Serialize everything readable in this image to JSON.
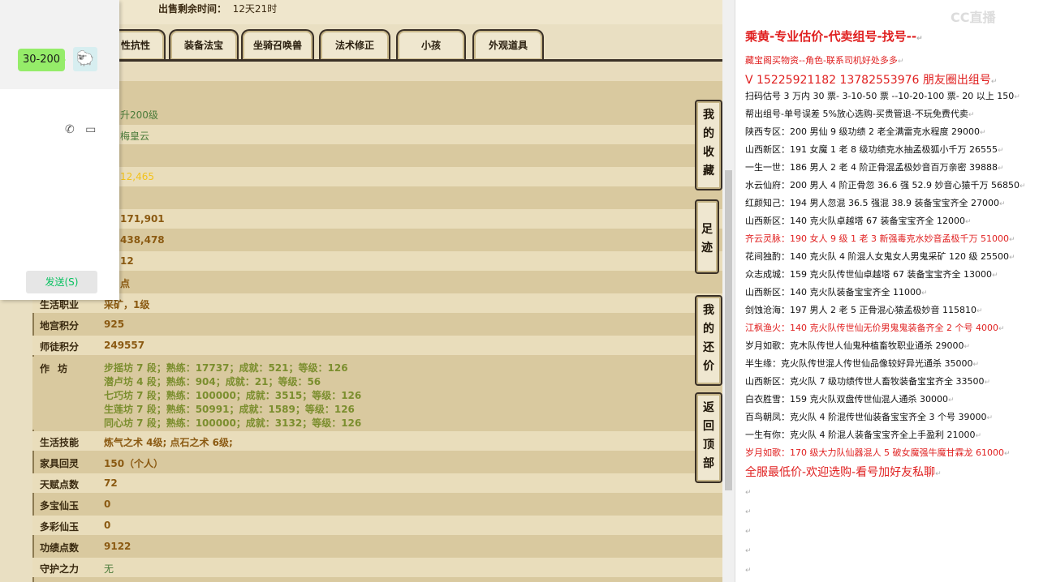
{
  "sale": {
    "label": "出售剩余时间：",
    "value": "12天21时"
  },
  "tabs": [
    "性抗性",
    "装备法宝",
    "坐骑召唤兽",
    "法术修正",
    "小孩",
    "外观道具"
  ],
  "rows": [
    {
      "label": "",
      "value": "升200级"
    },
    {
      "label": "",
      "value": "梅皇云"
    },
    {
      "label": "",
      "value": ""
    },
    {
      "label": "",
      "value": "12,465"
    },
    {
      "label": "",
      "value": ""
    },
    {
      "label": "",
      "value": "171,901"
    },
    {
      "label": "",
      "value": "438,478"
    },
    {
      "label": "",
      "value": "12"
    },
    {
      "label": "",
      "value": "点"
    },
    {
      "label": "生活职业",
      "value": "采矿，1级"
    },
    {
      "label": "地宫积分",
      "value": "925"
    },
    {
      "label": "师徒积分",
      "value": "249557"
    }
  ],
  "workshop": {
    "label": "作坊",
    "lines": [
      "步摇坊 7 段；熟练：17737；成就：521；等级：126",
      "潜卢坊 4 段；熟练：904；成就：21；等级：56",
      "七巧坊 7 段；熟练：100000；成就：3515；等级：126",
      "生莲坊 7 段；熟练：50991；成就：1589；等级：126",
      "同心坊 7 段；熟练：100000；成就：3132；等级：126"
    ]
  },
  "rows2": [
    {
      "label": "生活技能",
      "value": "炼气之术 4级; 点石之术 6级;"
    },
    {
      "label": "家具回灵",
      "value": "150（个人）"
    },
    {
      "label": "天赋点数",
      "value": "72"
    },
    {
      "label": "多宝仙玉",
      "value": "0"
    },
    {
      "label": "多彩仙玉",
      "value": "0"
    },
    {
      "label": "功绩点数",
      "value": "9122"
    },
    {
      "label": "守护之力",
      "value": "无"
    }
  ],
  "side_buttons": [
    {
      "chars": [
        "我",
        "的",
        "收",
        "藏"
      ]
    },
    {
      "chars": [
        "足",
        "迹"
      ]
    },
    {
      "chars": [
        "我",
        "的",
        "还",
        "价"
      ]
    },
    {
      "chars": [
        "返",
        "回",
        "顶",
        "部"
      ]
    }
  ],
  "chat": {
    "bubble": "30-200",
    "send_label": "发送(S)",
    "avatar": "🐑",
    "call_icon": "✆",
    "video_icon": "▭"
  },
  "watermark": "CC直播",
  "doc_lines": [
    {
      "text": "乘黄-专业估价-代卖组号-找号--",
      "style": "red big"
    },
    {
      "text": "藏宝阁买物资--角色-联系司机好处多多",
      "style": "red"
    },
    {
      "text": "V 15225921182   13782553976 朋友圈出组号",
      "style": "red mid"
    },
    {
      "text": "扫码估号 3 万内 30 票- 3-10-50 票  --10-20-100 票- 20 以上 150",
      "style": ""
    },
    {
      "text": "帮出组号-单号误差 5%放心选购-买贵管退-不玩免费代卖",
      "style": ""
    },
    {
      "text": "陕西专区：200 男仙 9 级功绩 2 老全满雷克水程度 29000",
      "style": ""
    },
    {
      "text": "山西新区：191 女魔 1 老 8 级功绩克水抽孟极狐小千万 26555",
      "style": ""
    },
    {
      "text": "一生一世：186 男人 2 老 4 阶正骨混孟极妙音百万亲密 39888",
      "style": ""
    },
    {
      "text": "水云仙府：200 男人 4 阶正骨忽 36.6 强 52.9 妙音心猿千万 56850",
      "style": ""
    },
    {
      "text": "红颜知己：194 男人忽混 36.5 强混 38.9 装备宝宝齐全 27000",
      "style": ""
    },
    {
      "text": "山西新区：140 克火队卓越塔 67 装备宝宝齐全  12000",
      "style": ""
    },
    {
      "text": "齐云灵脉：190 女人 9 级 1 老 3 新强毒克水妙音孟极千万 51000",
      "style": "red"
    },
    {
      "text": "花间独酌：140 克火队 4 阶混人女鬼女人男鬼采矿 120 级 25500",
      "style": ""
    },
    {
      "text": "众志成城：159 克火队传世仙卓越塔 67 装备宝宝齐全 13000",
      "style": ""
    },
    {
      "text": "山西新区：140 克火队装备宝宝齐全 11000",
      "style": ""
    },
    {
      "text": "剑蚀沧海：197 男人 2 老 5 正骨混心猿孟极妙音 115810",
      "style": ""
    },
    {
      "text": "江枫渔火：140 克火队传世仙无价男鬼鬼装备齐全 2 个号 4000",
      "style": "red"
    },
    {
      "text": "岁月如歌：克木队传世人仙鬼种植畜牧职业通杀 29000",
      "style": ""
    },
    {
      "text": "半生缘：克火队传世混人传世仙品像较好异光通杀 35000",
      "style": ""
    },
    {
      "text": "山西新区：克火队 7 级功绩传世人畜牧装备宝宝齐全 33500",
      "style": ""
    },
    {
      "text": "白衣胜雪：159 克火队双盘传世仙混人通杀 30000",
      "style": ""
    },
    {
      "text": "百鸟朝凤：克火队 4 阶混传世仙装备宝宝齐全 3 个号 39000",
      "style": ""
    },
    {
      "text": "一生有你：克火队 4 阶混人装备宝宝齐全上手盈利 21000",
      "style": ""
    },
    {
      "text": "岁月如歌：170 级大力队仙器混人 5 破女魔强牛魔甘霖龙 61000",
      "style": "red"
    },
    {
      "text": "全服最低价-欢迎选购-看号加好友私聊",
      "style": "red mid"
    }
  ],
  "para_mark": "↵"
}
